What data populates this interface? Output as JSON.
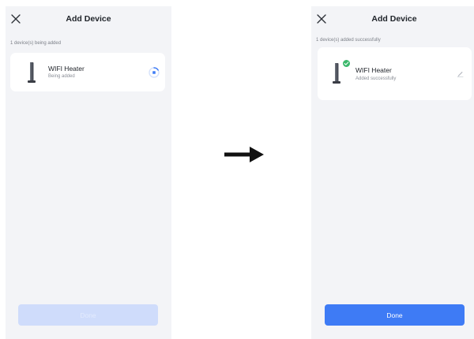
{
  "screens": {
    "before": {
      "title": "Add Device",
      "status_text": "1 device(s) being added",
      "device": {
        "name": "WIFI Heater",
        "status": "Being added",
        "icon": "heater-icon"
      },
      "done_label": "Done",
      "done_enabled": false
    },
    "after": {
      "title": "Add Device",
      "status_text": "1 device(s) added successfully",
      "device": {
        "name": "WIFI Heater",
        "status": "Added successfully",
        "icon": "heater-icon"
      },
      "done_label": "Done",
      "done_enabled": true
    }
  },
  "colors": {
    "accent": "#3e7bf5",
    "accent_disabled": "#cfdcfb",
    "success": "#3bb86b",
    "screen_bg": "#f3f4f7"
  }
}
